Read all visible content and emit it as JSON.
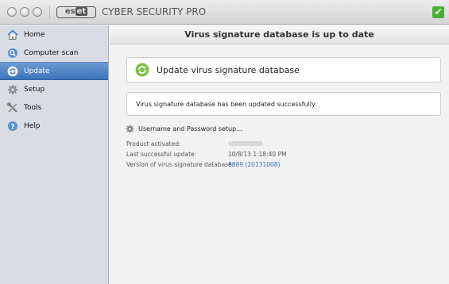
{
  "titlebar": {
    "logo_text": "eset",
    "app_title": "CYBER SECURITY PRO",
    "status_icon": "check-icon",
    "status_color": "#46b035"
  },
  "sidebar": {
    "items": [
      {
        "label": "Home",
        "icon": "home-icon"
      },
      {
        "label": "Computer scan",
        "icon": "search-icon"
      },
      {
        "label": "Update",
        "icon": "update-icon",
        "active": true
      },
      {
        "label": "Setup",
        "icon": "gear-icon"
      },
      {
        "label": "Tools",
        "icon": "tools-icon"
      },
      {
        "label": "Help",
        "icon": "help-icon"
      }
    ],
    "active_color": "#3b73b8"
  },
  "main": {
    "header_title": "Virus signature database is up to date",
    "update_button_label": "Update virus signature database",
    "message": "Virus signature database has been updated successfully.",
    "credentials_link": "Username and Password setup...",
    "info": {
      "product_activated_label": "Product activated:",
      "last_update_label": "Last successful update:",
      "last_update_value": "10/8/13 1:18:40 PM",
      "version_label": "Version of virus signature database:",
      "version_value": "8889 (20131008)"
    }
  }
}
